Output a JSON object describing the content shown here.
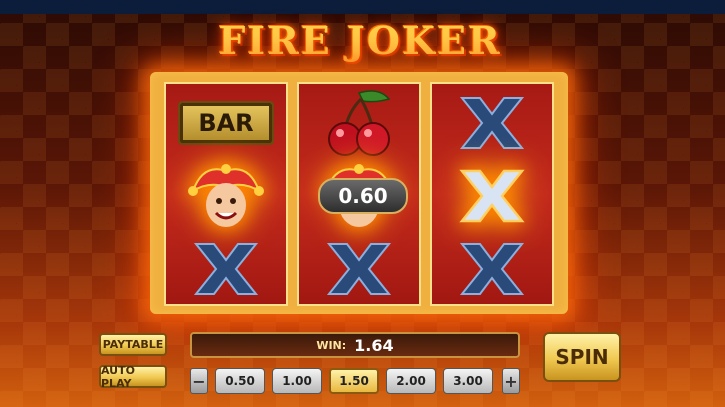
{
  "game": {
    "title": "FIRE JOKER"
  },
  "reels": [
    {
      "symbols": [
        "bar",
        "joker",
        "x-blue"
      ]
    },
    {
      "symbols": [
        "cherry",
        "joker",
        "x-blue"
      ]
    },
    {
      "symbols": [
        "x-blue",
        "x-glowing",
        "x-blue"
      ]
    }
  ],
  "symbols": {
    "bar_label": "BAR"
  },
  "win_badge": {
    "value": "0.60"
  },
  "controls": {
    "paytable_label": "PAYTABLE",
    "autoplay_label": "AUTO PLAY",
    "spin_label": "SPIN",
    "win_label": "WIN:",
    "win_value": "1.64"
  },
  "bets": {
    "options": [
      "0.50",
      "1.00",
      "1.50",
      "2.00",
      "3.00"
    ],
    "selected": "1.50",
    "decrease_icon": "minus-arrow-icon",
    "increase_icon": "plus-arrow-icon"
  },
  "colors": {
    "accent_gold": "#f0c850",
    "reel_red": "#c42a1c",
    "fire": "#ff6a00"
  }
}
